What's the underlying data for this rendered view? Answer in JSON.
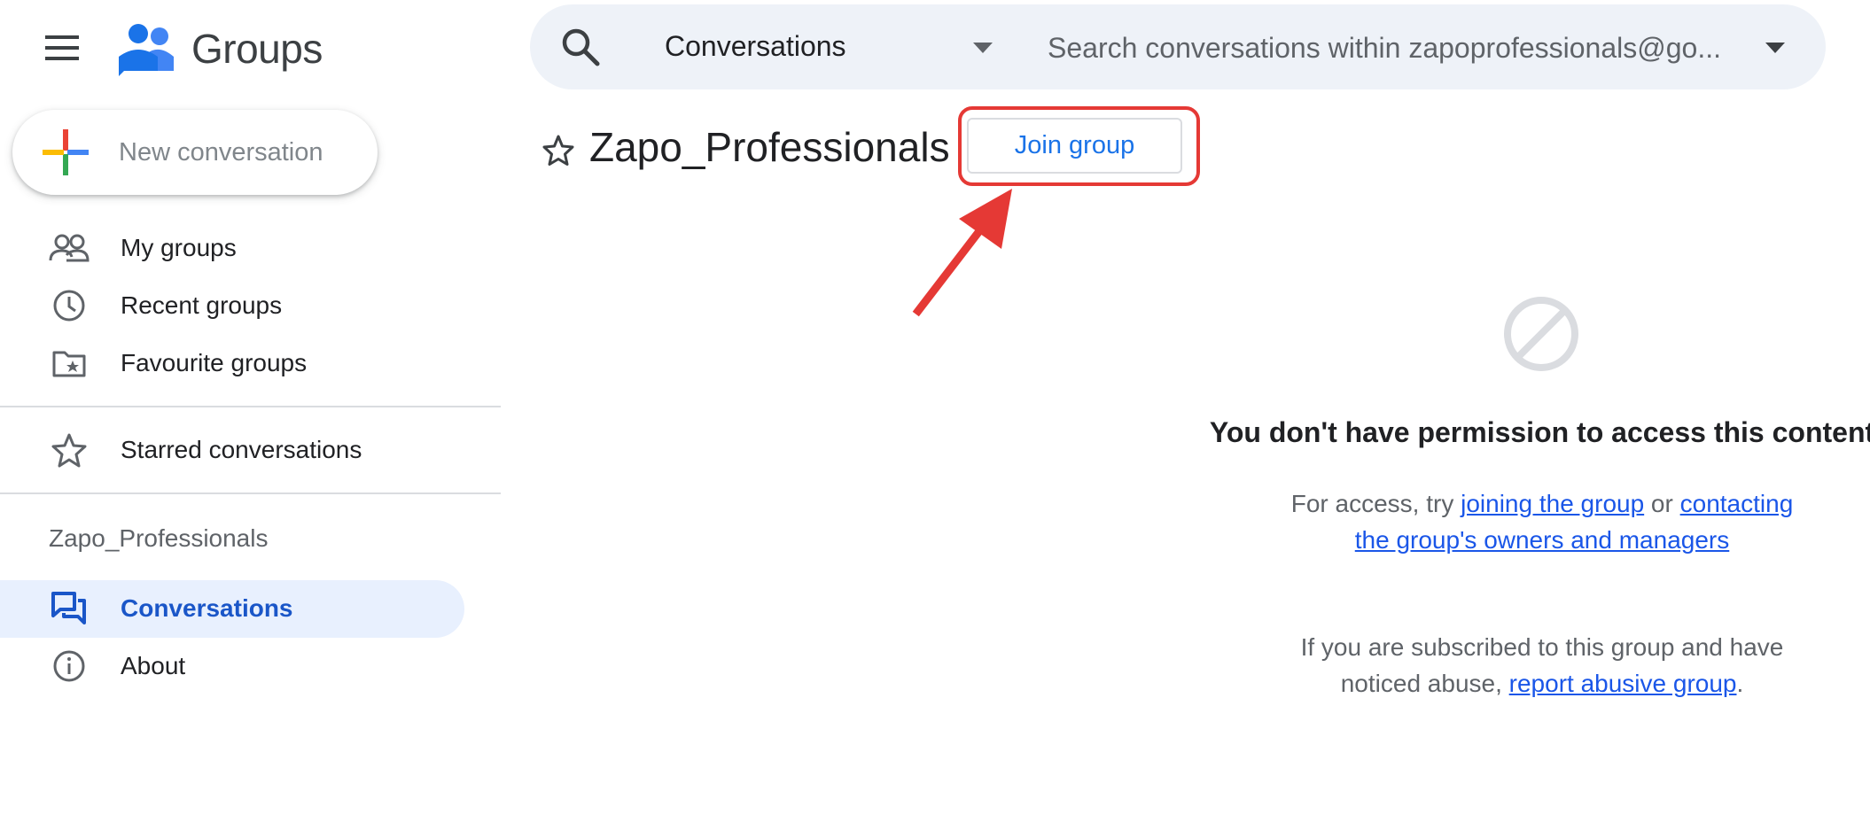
{
  "app": {
    "name": "Groups"
  },
  "sidebar": {
    "new_conversation": "New conversation",
    "items": [
      {
        "label": "My groups",
        "icon": "people-icon"
      },
      {
        "label": "Recent groups",
        "icon": "clock-icon"
      },
      {
        "label": "Favourite groups",
        "icon": "folder-star-icon"
      }
    ],
    "starred": {
      "label": "Starred conversations",
      "icon": "star-icon"
    },
    "group_name": "Zapo_Professionals",
    "group_items": [
      {
        "label": "Conversations",
        "icon": "forum-icon",
        "active": true
      },
      {
        "label": "About",
        "icon": "info-icon",
        "active": false
      }
    ]
  },
  "search": {
    "scope": "Conversations",
    "placeholder": "Search conversations within zapoprofessionals@go..."
  },
  "group": {
    "title": "Zapo_Professionals",
    "join_label": "Join group"
  },
  "permission": {
    "title": "You don't have permission to access this content",
    "access_prefix": "For access, try ",
    "join_link": "joining the group",
    "or_text": " or ",
    "contact_link": "contacting the group's owners and managers",
    "abuse_prefix": "If you are subscribed to this group and have noticed abuse, ",
    "abuse_link": "report abusive group",
    "abuse_suffix": "."
  },
  "colors": {
    "accent": "#1a73e8",
    "active_bg": "#e8f0fe",
    "annotation": "#e53935"
  }
}
